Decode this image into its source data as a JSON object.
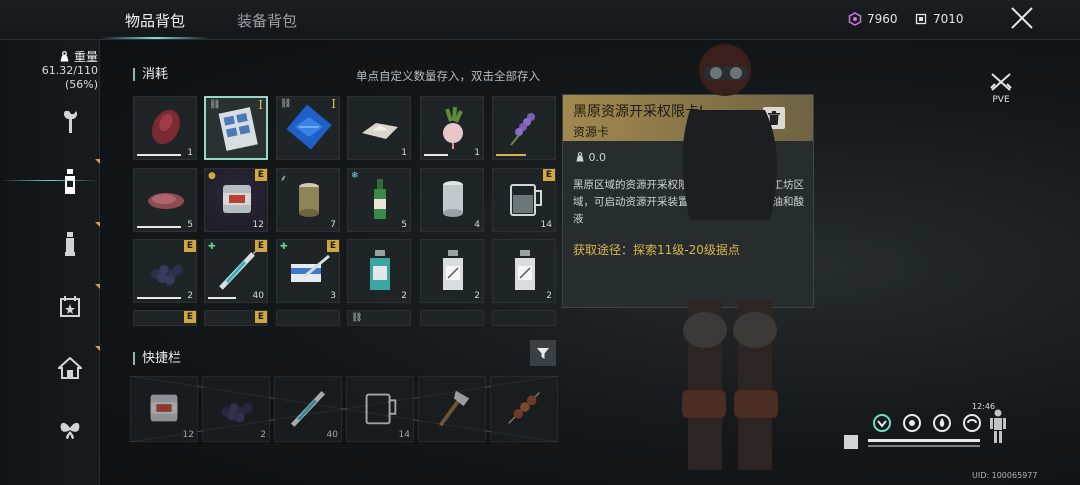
{
  "tabs": [
    {
      "label": "物品背包",
      "active": true
    },
    {
      "label": "装备背包",
      "active": false
    }
  ],
  "currency": [
    {
      "icon": "hex-gem-icon",
      "value": "7960"
    },
    {
      "icon": "chip-icon",
      "value": "7010"
    }
  ],
  "weight": {
    "label": "重量",
    "value": "61.32/110",
    "percent": "(56%)"
  },
  "sidebar": {
    "items": [
      {
        "icon": "wrench-icon"
      },
      {
        "icon": "bottle-icon",
        "active": true
      },
      {
        "icon": "bullet-icon"
      },
      {
        "icon": "calendar-star-icon"
      },
      {
        "icon": "house-icon"
      },
      {
        "icon": "butterfly-icon"
      }
    ]
  },
  "consumables": {
    "title": "消耗",
    "hint": "单点自定义数量存入，双击全部存入",
    "slots": [
      {
        "icon": "raw-meat-icon",
        "count": "1"
      },
      {
        "icon": "resource-card-icon",
        "count": "",
        "badge": "I",
        "linked": true,
        "selected": true
      },
      {
        "icon": "blue-card-icon",
        "count": "",
        "badge": "I",
        "linked": true
      },
      {
        "icon": "salt-pile-icon",
        "count": "1"
      },
      {
        "icon": "beet-icon",
        "count": "1"
      },
      {
        "icon": "lavender-icon",
        "count": ""
      },
      {
        "icon": "sliced-meat-icon",
        "count": "5"
      },
      {
        "icon": "canned-meat-icon",
        "count": "12",
        "badge": "E",
        "rare": true
      },
      {
        "icon": "tin-can-icon",
        "count": "7"
      },
      {
        "icon": "soju-bottle-icon",
        "count": "5"
      },
      {
        "icon": "metal-can-icon",
        "count": "4"
      },
      {
        "icon": "water-mug-icon",
        "count": "14",
        "badge": "E"
      },
      {
        "icon": "blueberries-icon",
        "count": "2",
        "badge": "E"
      },
      {
        "icon": "syringe-icon",
        "count": "40",
        "badge": "E"
      },
      {
        "icon": "medkit-syringe-icon",
        "count": "3",
        "badge": "E"
      },
      {
        "icon": "vial-teal-icon",
        "count": "2"
      },
      {
        "icon": "vial-white-icon",
        "count": "2"
      },
      {
        "icon": "vial-white-icon",
        "count": "2"
      }
    ]
  },
  "tooltip": {
    "name": "黑原资源开采权限卡I",
    "type": "资源卡",
    "weight": "0.0",
    "description": "黑原区域的资源开采权限卡，前往聚落内的工坊区域，可启动资源开采装置，获取便携混合燃油和酸液",
    "source": "获取途径：探索11级-20级据点"
  },
  "quickbar": {
    "title": "快捷栏",
    "slots": [
      {
        "icon": "canned-meat-icon",
        "count": "12"
      },
      {
        "icon": "blueberries-icon",
        "count": "2"
      },
      {
        "icon": "syringe-icon",
        "count": "40"
      },
      {
        "icon": "water-mug-icon",
        "count": "14"
      },
      {
        "icon": "axe-icon",
        "count": ""
      },
      {
        "icon": "kebab-icon",
        "count": ""
      }
    ]
  },
  "mode": {
    "label": "PVE"
  },
  "status": {
    "time": "12:46"
  },
  "uid": "UID: 100065977",
  "colors": {
    "accent": "#7fe0d8",
    "gold": "#d0a93e",
    "tooltip_source": "#d8b547"
  }
}
